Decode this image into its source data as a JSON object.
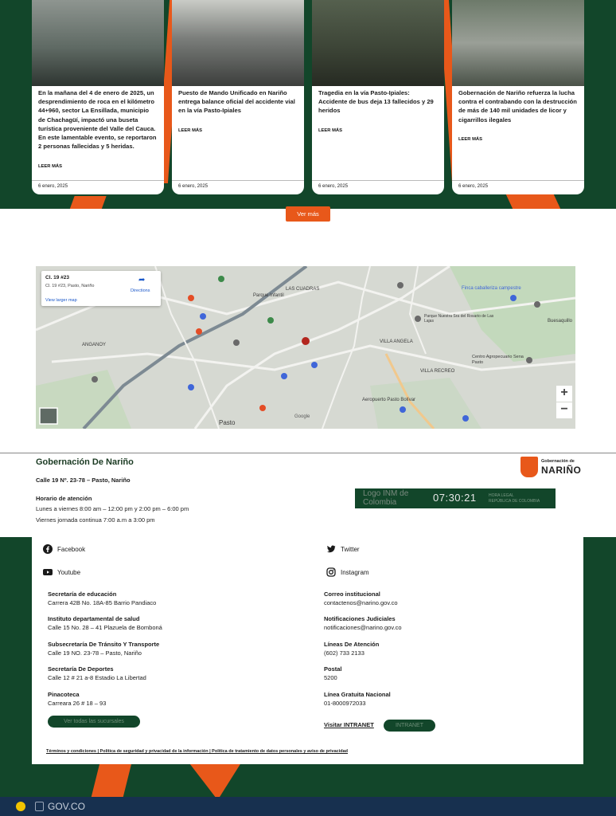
{
  "news": {
    "cards": [
      {
        "text": "En la mañana del 4 de enero de 2025, un desprendimiento de roca en el kilómetro 44+960, sector La Ensillada, municipio de Chachagüí, impactó una buseta turística proveniente del Valle del Cauca. En este lamentable evento, se reportaron 2 personas fallecidas y 5 heridas.",
        "more": "LEER MÁS",
        "date": "6 enero, 2025"
      },
      {
        "text": "Puesto de Mando Unificado en Nariño entrega balance oficial del accidente vial en la vía Pasto-Ipiales",
        "more": "LEER MÁS",
        "date": "6 enero, 2025"
      },
      {
        "text": "Tragedia en la vía Pasto-Ipiales: Accidente de bus deja 13 fallecidos y 29 heridos",
        "more": "LEER MÁS",
        "date": "6 enero, 2025"
      },
      {
        "text": "Gobernación de Nariño refuerza la lucha contra el contrabando con la destrucción de más de 140 mil unidades de licor y cigarrillos ilegales",
        "more": "LEER MÁS",
        "date": "6 enero, 2025"
      }
    ],
    "see_more": "Ver más"
  },
  "map": {
    "place_title": "Cl. 19 #23",
    "place_address": "Cl. 19 #23, Pasto, Nariño",
    "directions": "Directions",
    "view_larger": "View larger map",
    "zoom_in": "+",
    "zoom_out": "−",
    "labels": [
      "LAS CUADRAS",
      "ANGANOY",
      "VILLA ANGELA",
      "VILLA RECREO",
      "Pasto",
      "Parque Infantil",
      "Parque Nuestra Sra del Rosario de Las Lajas",
      "Centro Agropecuario Sena Pasto",
      "Aeropuerto Pasto Bolívar",
      "Buesaquillo",
      "Finca caballeriza campestre",
      "Google"
    ]
  },
  "gov": {
    "title": "Gobernación De Nariño",
    "address": "Calle 19 Nº. 23-78 – Pasto, Nariño",
    "schedule_title": "Horario de atención",
    "schedule_1": "Lunes a viernes 8:00 am – 12:00 pm y 2:00 pm – 6:00 pm",
    "schedule_2": "Viernes jornada continua 7:00 a.m  a 3:00 pm",
    "logo_small": "Gobernación de",
    "logo_big": "NARIÑO",
    "clock_alt": "Logo INM de Colombia",
    "clock_time": "07:30:21",
    "clock_legend_1": "HORA LEGAL",
    "clock_legend_2": "REPÚBLICA DE COLOMBIA"
  },
  "footer": {
    "social": {
      "facebook": "Facebook",
      "twitter": "Twitter",
      "youtube": "Youtube",
      "instagram": "Instagram"
    },
    "left": [
      {
        "name": "Secretaría de educación",
        "value": "Carrera 42B No. 18A-85 Barrio Pandiaco"
      },
      {
        "name": "Instituto departamental de salud",
        "value": "Calle 15 No. 28 – 41 Plazuela de Bomboná"
      },
      {
        "name": "Subsecretaría De Tránsito Y Transporte",
        "value": "Calle  19 NO. 23-78 – Pasto, Nariño"
      },
      {
        "name": "Secretaría De Deportes",
        "value": "Calle 12 # 21 a-8 Estadio La Libertad"
      },
      {
        "name": "Pinacoteca",
        "value": "Carreara 26 # 18 – 93"
      }
    ],
    "right": [
      {
        "name": "Correo institucional",
        "value": "contactenos@narino.gov.co"
      },
      {
        "name": "Notificaciones Judiciales",
        "value": "notificaciones@narino.gov.co"
      },
      {
        "name": "Líneas De Atención",
        "value": "(602) 733 2133"
      },
      {
        "name": "Postal",
        "value": "5200"
      },
      {
        "name": "Línea Gratuita Nacional",
        "value": "01-8000972033"
      }
    ],
    "branches_button": "Ver todas las sucursales",
    "intranet_link": "Visitar INTRANET",
    "intranet_button": "INTRANET",
    "terms": "Términos y condiciones  |  Política de seguridad y privacidad de la información  |  Política de tratamiento de datos personales y aviso de privacidad"
  },
  "govco": {
    "label": "GOV.CO"
  }
}
